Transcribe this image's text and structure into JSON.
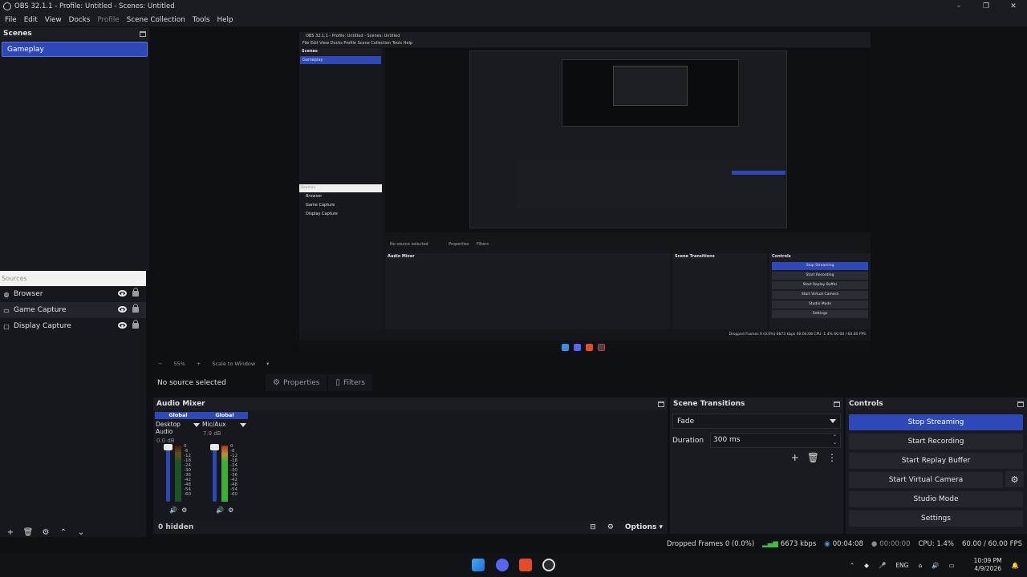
{
  "window": {
    "title": "OBS 32.1.1 - Profile: Untitled - Scenes: Untitled"
  },
  "menu": [
    "File",
    "Edit",
    "View",
    "Docks",
    "Profile",
    "Scene Collection",
    "Tools",
    "Help"
  ],
  "scenes": {
    "header": "Scenes",
    "items": [
      "Gameplay"
    ]
  },
  "sources": {
    "header": "Sources",
    "items": [
      {
        "label": "Browser",
        "icon": "globe-icon"
      },
      {
        "label": "Game Capture",
        "icon": "gamepad-icon"
      },
      {
        "label": "Display Capture",
        "icon": "monitor-icon"
      }
    ]
  },
  "preview": {
    "zoom": "55%",
    "scale_mode": "Scale to Window"
  },
  "nested": {
    "title": "OBS 32.1.1 - Profile: Untitled - Scenes: Untitled",
    "menu": "File  Edit  View  Docks  Profile  Scene Collection  Tools  Help",
    "scenes_header": "Scenes",
    "scene": "Gameplay",
    "sources_header": "Sources",
    "sources": [
      "Browser",
      "Game Capture",
      "Display Capture"
    ],
    "no_source": "No source selected",
    "properties": "Properties",
    "filters": "Filters",
    "mixer": "Audio Mixer",
    "transitions": "Scene Transitions",
    "controls": "Controls",
    "ctrl_buttons": [
      "Stop Streaming",
      "Start Recording",
      "Start Replay Buffer",
      "Start Virtual Camera",
      "Studio Mode",
      "Settings"
    ],
    "status": "Dropped Frames 0 (0.0%)   6673 kbps   00:04:08   CPU: 1.4%   60.00 / 60.00 FPS"
  },
  "source_bar": {
    "no_source": "No source selected",
    "properties": "Properties",
    "filters": "Filters"
  },
  "mixer": {
    "header": "Audio Mixer",
    "channels": [
      {
        "tag": "Global",
        "name": "Desktop Audio",
        "db": "0.0 dB"
      },
      {
        "tag": "Global",
        "name": "Mic/Aux",
        "db": "7.9 dB"
      }
    ],
    "scale": [
      "0",
      "-6",
      "-12",
      "-18",
      "-24",
      "-30",
      "-36",
      "-42",
      "-48",
      "-54",
      "-60"
    ],
    "hidden_label": "0 hidden",
    "options_label": "Options"
  },
  "transitions": {
    "header": "Scene Transitions",
    "selected": "Fade",
    "duration_label": "Duration",
    "duration_value": "300 ms"
  },
  "controls": {
    "header": "Controls",
    "buttons": [
      "Stop Streaming",
      "Start Recording",
      "Start Replay Buffer",
      "Start Virtual Camera",
      "Studio Mode",
      "Settings"
    ]
  },
  "status": {
    "dropped": "Dropped Frames 0 (0.0%)",
    "bitrate": "6673 kbps",
    "stream_time": "00:04:08",
    "rec_time": "00:00:00",
    "cpu": "CPU: 1.4%",
    "fps": "60.00 / 60.00 FPS"
  },
  "taskbar": {
    "lang": "ENG",
    "time": "10:09 PM",
    "date": "4/9/2026"
  },
  "colors": {
    "accent": "#2f48b8",
    "background": "#1a1b20",
    "meter_green": "#3fbf3f",
    "meter_red": "#c03030"
  }
}
